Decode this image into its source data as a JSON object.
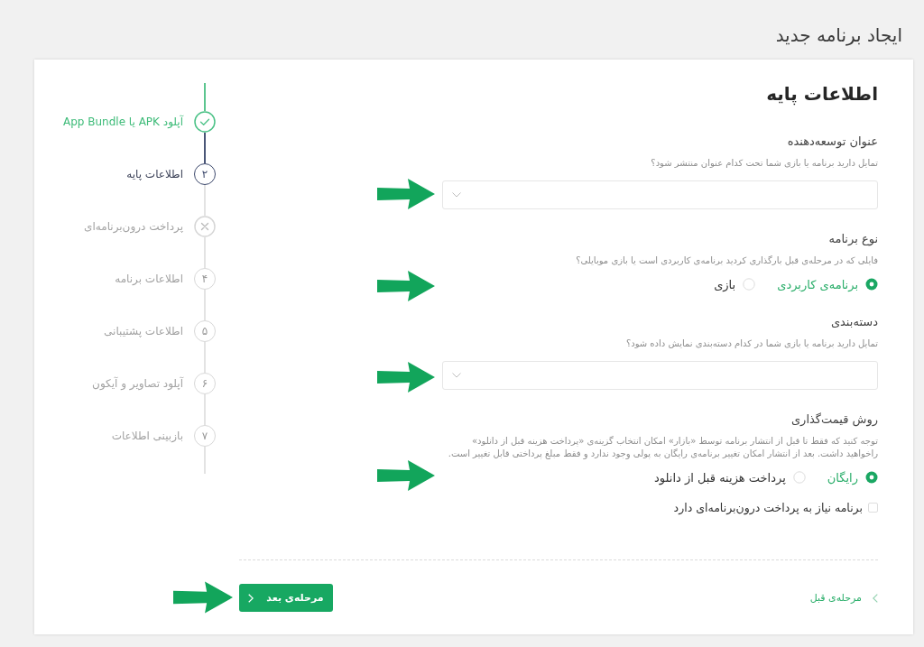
{
  "page": {
    "title": "ایجاد برنامه جدید"
  },
  "stepper": {
    "steps": [
      {
        "label": "آپلود APK یا App Bundle",
        "completed": true,
        "selected": false,
        "skipped": false
      },
      {
        "label": "اطلاعات پایه",
        "number": "۲",
        "completed": false,
        "selected": true,
        "skipped": false
      },
      {
        "label": "پرداخت درون‌برنامه‌ای",
        "completed": false,
        "selected": false,
        "skipped": true
      },
      {
        "label": "اطلاعات برنامه",
        "number": "۴",
        "completed": false,
        "selected": false,
        "skipped": false
      },
      {
        "label": "اطلاعات پشتیبانی",
        "number": "۵",
        "completed": false,
        "selected": false,
        "skipped": false
      },
      {
        "label": "آپلود تصاویر و آیکون",
        "number": "۶",
        "completed": false,
        "selected": false,
        "skipped": false
      },
      {
        "label": "بازبینی اطلاعات",
        "number": "۷",
        "completed": false,
        "selected": false,
        "skipped": false
      }
    ]
  },
  "form": {
    "heading": "اطلاعات پایه",
    "fields": [
      {
        "kind": "select",
        "label": "عنوان توسعه‌دهنده",
        "hint": "تمایل دارید برنامه یا بازی شما تحت کدام عنوان منتشر شود؟"
      },
      {
        "kind": "radio",
        "label": "نوع برنامه",
        "hint": "فایلی که در مرحله‌ی قبل بارگذاری کردید برنامه‌ی کاربردی است یا بازی موبایلی؟",
        "options": [
          {
            "label": "برنامه‌ی کاربردی",
            "selected": true
          },
          {
            "label": "بازی",
            "selected": false
          }
        ]
      },
      {
        "kind": "select",
        "label": "دسته‌بندی",
        "hint": "تمایل دارید برنامه یا بازی شما در کدام دسته‌بندی نمایش داده شود؟"
      },
      {
        "kind": "radio",
        "label": "روش قیمت‌گذاری",
        "hint": "توجه کنید که فقط تا قبل از انتشار برنامه توسط «بازار» امکان انتخاب گزینه‌ی «پرداخت هزینه قبل از دانلود» راخواهید داشت. بعد از انتشار امکان تغییر برنامه‌ی رایگان به پولی وجود ندارد و فقط مبلغ پرداختی قابل تغییر است.",
        "options": [
          {
            "label": "رایگان",
            "selected": true
          },
          {
            "label": "پرداخت هزینه قبل از دانلود",
            "selected": false
          }
        ],
        "checkbox": {
          "label": "برنامه نیاز به پرداخت درون‌برنامه‌ای دارد",
          "checked": false
        }
      }
    ]
  },
  "footer": {
    "next_button": {
      "label": "مرحله‌ی بعد"
    },
    "back_link": {
      "label": "مرحله‌ی قبل"
    }
  }
}
